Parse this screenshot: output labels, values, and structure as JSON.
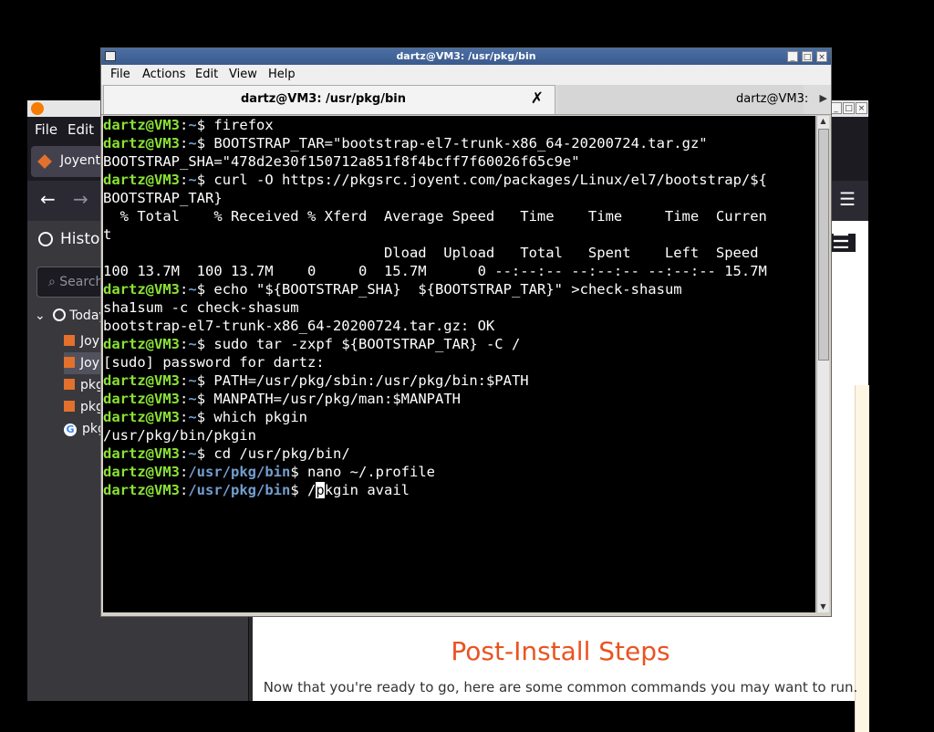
{
  "firefox": {
    "menu": [
      "File",
      "Edit"
    ],
    "tab_label": "Joyent",
    "sidebar": {
      "header": "Histo",
      "search_placeholder": "Search",
      "group": "Today",
      "items": [
        {
          "label": "Joy",
          "icon": "joyent-favicon-icon"
        },
        {
          "label": "Joy",
          "icon": "joyent-favicon-icon"
        },
        {
          "label": "pkg",
          "icon": "joyent-favicon-icon"
        },
        {
          "label": "pkg",
          "icon": "joyent-favicon-icon"
        },
        {
          "label": "pkg",
          "icon": "google-icon"
        }
      ]
    },
    "page": {
      "heading": "Post-Install Steps",
      "subtext": "Now that you're ready to go, here are some common commands you may want to run."
    }
  },
  "terminal": {
    "title": "dartz@VM3: /usr/pkg/bin",
    "menu": [
      "File",
      "Actions",
      "Edit",
      "View",
      "Help"
    ],
    "tabs": [
      "dartz@VM3: /usr/pkg/bin",
      "dartz@VM3:"
    ],
    "lines": [
      {
        "user": "dartz@VM3",
        "path": "~",
        "cmd": " firefox"
      },
      {
        "user": "dartz@VM3",
        "path": "~",
        "cmd": " BOOTSTRAP_TAR=\"bootstrap-el7-trunk-x86_64-20200724.tar.gz\""
      },
      {
        "text": "BOOTSTRAP_SHA=\"478d2e30f150712a851f8f4bcff7f60026f65c9e\""
      },
      {
        "user": "dartz@VM3",
        "path": "~",
        "cmd": " curl -O https://pkgsrc.joyent.com/packages/Linux/el7/bootstrap/${"
      },
      {
        "text": "BOOTSTRAP_TAR}"
      },
      {
        "text": "  % Total    % Received % Xferd  Average Speed   Time    Time     Time  Curren"
      },
      {
        "text": "t"
      },
      {
        "text": "                                 Dload  Upload   Total   Spent    Left  Speed"
      },
      {
        "text": "100 13.7M  100 13.7M    0     0  15.7M      0 --:--:-- --:--:-- --:--:-- 15.7M"
      },
      {
        "user": "dartz@VM3",
        "path": "~",
        "cmd": " echo \"${BOOTSTRAP_SHA}  ${BOOTSTRAP_TAR}\" >check-shasum"
      },
      {
        "text": "sha1sum -c check-shasum"
      },
      {
        "text": "bootstrap-el7-trunk-x86_64-20200724.tar.gz: OK"
      },
      {
        "user": "dartz@VM3",
        "path": "~",
        "cmd": " sudo tar -zxpf ${BOOTSTRAP_TAR} -C /"
      },
      {
        "text": "[sudo] password for dartz:"
      },
      {
        "user": "dartz@VM3",
        "path": "~",
        "cmd": " PATH=/usr/pkg/sbin:/usr/pkg/bin:$PATH"
      },
      {
        "user": "dartz@VM3",
        "path": "~",
        "cmd": " MANPATH=/usr/pkg/man:$MANPATH"
      },
      {
        "user": "dartz@VM3",
        "path": "~",
        "cmd": " which pkgin"
      },
      {
        "text": "/usr/pkg/bin/pkgin"
      },
      {
        "user": "dartz@VM3",
        "path": "~",
        "cmd": " cd /usr/pkg/bin/"
      },
      {
        "user": "dartz@VM3",
        "path": "/usr/pkg/bin",
        "cmd": " nano ~/.profile"
      },
      {
        "user": "dartz@VM3",
        "path": "/usr/pkg/bin",
        "cmd": " /",
        "cursor": "p",
        "after": "kgin avail"
      }
    ]
  }
}
